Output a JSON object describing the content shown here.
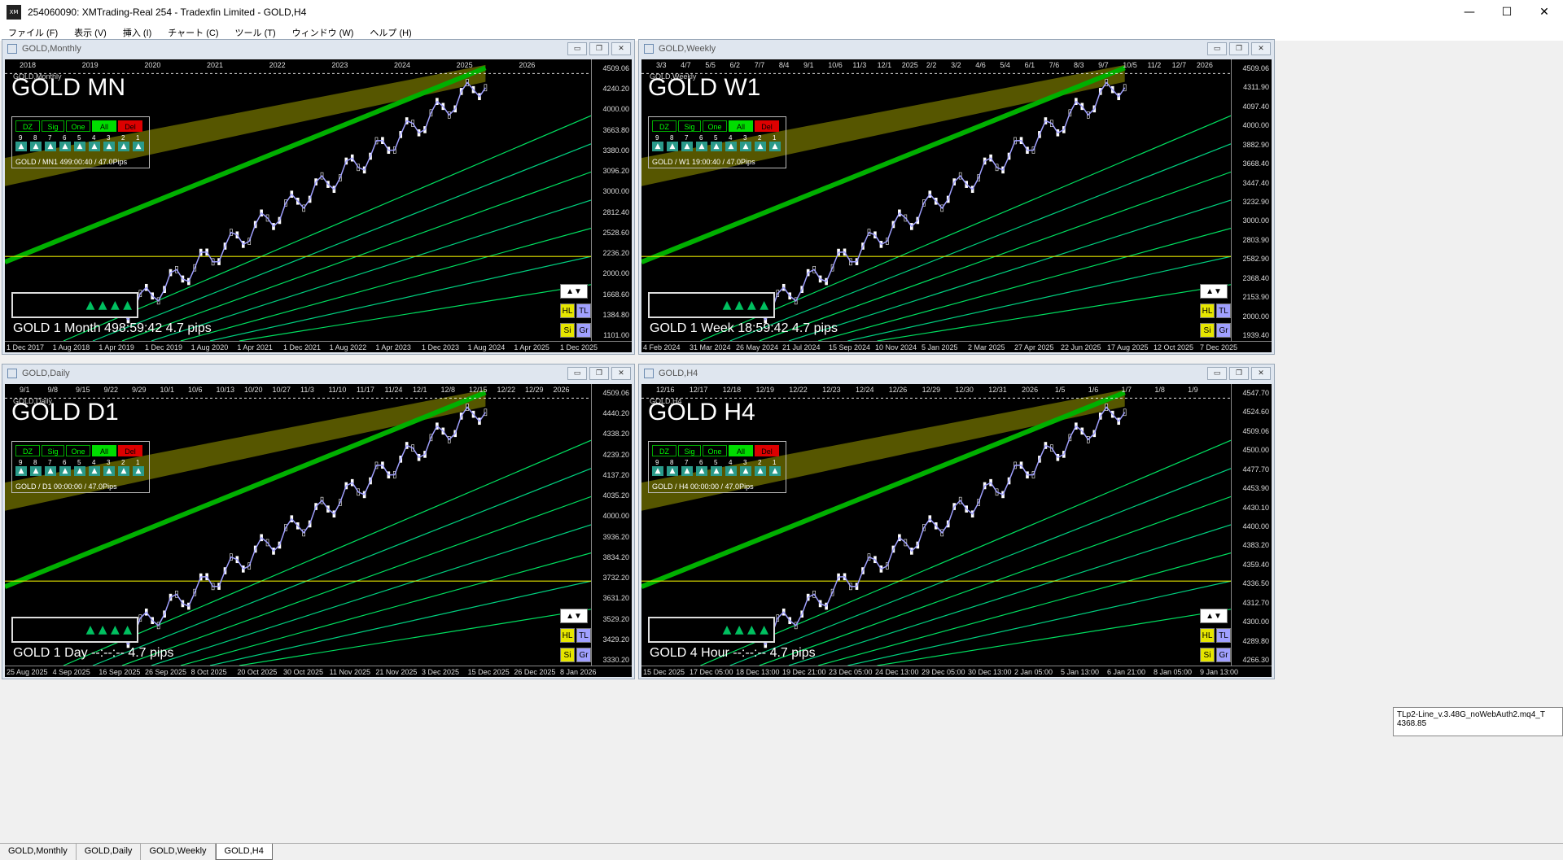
{
  "window": {
    "title": "254060090: XMTrading-Real 254 - Tradexfin Limited - GOLD,H4",
    "logo": "XM",
    "minimize": "—",
    "maximize": "☐",
    "close": "✕"
  },
  "menu": [
    "ファイル (F)",
    "表示 (V)",
    "挿入 (I)",
    "チャート (C)",
    "ツール (T)",
    "ウィンドウ (W)",
    "ヘルプ (H)"
  ],
  "panel_buttons": [
    "DZ",
    "Sig",
    "One",
    "All",
    "Del"
  ],
  "panel_numbers": [
    "9",
    "8",
    "7",
    "6",
    "5",
    "4",
    "3",
    "2",
    "1"
  ],
  "side_buttons": {
    "hl": "HL",
    "tl": "TL",
    "si": "Si",
    "gr": "Gr",
    "updown": "▲▼"
  },
  "windows": [
    {
      "title": "GOLD,Monthly",
      "small_label": "GOLD,Monthly",
      "tf_label": "GOLD MN",
      "panel_info": "GOLD / MN1 499:00:40 / 47.0Pips",
      "bottom_info": "GOLD  1 Month  498:59:42  4.7 pips",
      "price_labels": [
        "4509.06",
        "4240.20",
        "4000.00",
        "3663.80",
        "3380.00",
        "3096.20",
        "3000.00",
        "2812.40",
        "2528.60",
        "2236.20",
        "2000.00",
        "1668.60",
        "1384.80",
        "1101.00"
      ],
      "time_labels": [
        "1 Dec 2017",
        "1 Aug 2018",
        "1 Apr 2019",
        "1 Dec 2019",
        "1 Aug 2020",
        "1 Apr 2021",
        "1 Dec 2021",
        "1 Aug 2022",
        "1 Apr 2023",
        "1 Dec 2023",
        "1 Aug 2024",
        "1 Apr 2025",
        "1 Dec 2025"
      ],
      "top_labels": [
        "2018",
        "2019",
        "2020",
        "2021",
        "2022",
        "2023",
        "2024",
        "2025",
        "2026"
      ]
    },
    {
      "title": "GOLD,Weekly",
      "small_label": "GOLD,Weekly",
      "tf_label": "GOLD W1",
      "panel_info": "GOLD / W1 19:00:40 / 47.0Pips",
      "bottom_info": "GOLD  1 Week  18:59:42  4.7 pips",
      "price_labels": [
        "4509.06",
        "4311.90",
        "4097.40",
        "4000.00",
        "3882.90",
        "3668.40",
        "3447.40",
        "3232.90",
        "3000.00",
        "2803.90",
        "2582.90",
        "2368.40",
        "2153.90",
        "2000.00",
        "1939.40"
      ],
      "time_labels": [
        "4 Feb 2024",
        "31 Mar 2024",
        "26 May 2024",
        "21 Jul 2024",
        "15 Sep 2024",
        "10 Nov 2024",
        "5 Jan 2025",
        "2 Mar 2025",
        "27 Apr 2025",
        "22 Jun 2025",
        "17 Aug 2025",
        "12 Oct 2025",
        "7 Dec 2025"
      ],
      "top_labels": [
        "3/3",
        "4/7",
        "5/5",
        "6/2",
        "7/7",
        "8/4",
        "9/1",
        "10/6",
        "11/3",
        "12/1",
        "2025",
        "2/2",
        "3/2",
        "4/6",
        "5/4",
        "6/1",
        "7/6",
        "8/3",
        "9/7",
        "10/5",
        "11/2",
        "12/7",
        "2026"
      ]
    },
    {
      "title": "GOLD,Daily",
      "small_label": "GOLD,Daily",
      "tf_label": "GOLD D1",
      "panel_info": "GOLD / D1 00:00:00 / 47.0Pips",
      "bottom_info": "GOLD  1 Day  --:--:--  4.7 pips",
      "price_labels": [
        "4509.06",
        "4440.20",
        "4338.20",
        "4239.20",
        "4137.20",
        "4035.20",
        "4000.00",
        "3936.20",
        "3834.20",
        "3732.20",
        "3631.20",
        "3529.20",
        "3429.20",
        "3330.20"
      ],
      "time_labels": [
        "25 Aug 2025",
        "4 Sep 2025",
        "16 Sep 2025",
        "26 Sep 2025",
        "8 Oct 2025",
        "20 Oct 2025",
        "30 Oct 2025",
        "11 Nov 2025",
        "21 Nov 2025",
        "3 Dec 2025",
        "15 Dec 2025",
        "26 Dec 2025",
        "8 Jan 2026"
      ],
      "top_labels": [
        "9/1",
        "9/8",
        "9/15",
        "9/22",
        "9/29",
        "10/1",
        "10/6",
        "10/13",
        "10/20",
        "10/27",
        "11/3",
        "11/10",
        "11/17",
        "11/24",
        "12/1",
        "12/8",
        "12/15",
        "12/22",
        "12/29",
        "2026"
      ]
    },
    {
      "title": "GOLD,H4",
      "small_label": "GOLD,H4",
      "tf_label": "GOLD H4",
      "panel_info": "GOLD / H4 00:00:00 / 47.0Pips",
      "bottom_info": "GOLD  4 Hour  --:--:--  4.7 pips",
      "price_labels": [
        "4547.70",
        "4524.60",
        "4509.06",
        "4500.00",
        "4477.70",
        "4453.90",
        "4430.10",
        "4400.00",
        "4383.20",
        "4359.40",
        "4336.50",
        "4312.70",
        "4300.00",
        "4289.80",
        "4266.30"
      ],
      "time_labels": [
        "15 Dec 2025",
        "17 Dec 05:00",
        "18 Dec 13:00",
        "19 Dec 21:00",
        "23 Dec 05:00",
        "24 Dec 13:00",
        "29 Dec 05:00",
        "30 Dec 13:00",
        "2 Jan 05:00",
        "5 Jan 13:00",
        "6 Jan 21:00",
        "8 Jan 05:00",
        "9 Jan 13:00"
      ],
      "top_labels": [
        "12/16",
        "12/17",
        "12/18",
        "12/19",
        "12/22",
        "12/23",
        "12/24",
        "12/26",
        "12/29",
        "12/30",
        "12/31",
        "2026",
        "1/5",
        "1/6",
        "1/7",
        "1/8",
        "1/9"
      ]
    }
  ],
  "tooltip": {
    "line1": "TLp2-Line_v.3.48G_noWebAuth2.mq4_T",
    "line2": "4368.85"
  },
  "tabs": [
    "GOLD,Monthly",
    "GOLD,Daily",
    "GOLD,Weekly",
    "GOLD,H4"
  ],
  "colors": {
    "chart_bg": "#000000",
    "green": "#00c800",
    "olive": "#808000",
    "yellow": "#ffff00",
    "cyan": "#00ffff",
    "lavender": "#9999ff",
    "red": "#ff0000"
  }
}
